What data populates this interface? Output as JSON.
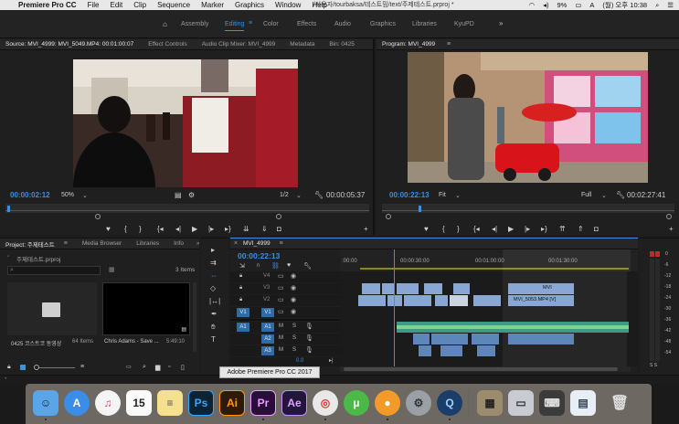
{
  "menubar": {
    "app_name": "Premiere Pro CC",
    "items": [
      "File",
      "Edit",
      "Clip",
      "Sequence",
      "Marker",
      "Graphics",
      "Window",
      "Help"
    ],
    "path_title": "/사용자/tourbaksa/테스트밈/text/주제테스트.prproj *",
    "battery": "9%",
    "clock": "(월) 오후 10:38"
  },
  "workspaces": [
    "Assembly",
    "Editing",
    "Color",
    "Effects",
    "Audio",
    "Graphics",
    "Libraries",
    "KyuPD"
  ],
  "active_workspace": "Editing",
  "source_panel": {
    "tabs": [
      "Source: MVI_4999: MVI_5049.MP4: 00:01:00:07",
      "Effect Controls",
      "Audio Clip Mixer: MVI_4999",
      "Metadata",
      "Bin: 0425"
    ],
    "timecode_in": "00:00:02:12",
    "zoom": "50%",
    "fraction": "1/2",
    "duration": "00:00:05:37"
  },
  "program_panel": {
    "tab": "Program: MVI_4999",
    "timecode": "00:00:22:13",
    "zoom": "Fit",
    "quality": "Full",
    "duration": "00:02:27:41"
  },
  "project_panel": {
    "tabs": [
      "Project: 주제테스트",
      "Media Browser",
      "Libraries",
      "Info"
    ],
    "file": "주제테스트.prproj",
    "item_count": "3 Items",
    "items": [
      {
        "name": "0425 코스트코 동영상",
        "meta": "64 Items"
      },
      {
        "name": "Chris Adams - Save ...",
        "meta": "5:49:10"
      }
    ]
  },
  "timeline": {
    "tab": "MVI_4999",
    "timecode": "00:00:22:13",
    "ruler": [
      ":00:00",
      "00:00:30:00",
      "00:01:00:00",
      "00:01:30:00"
    ],
    "video_tracks": [
      "V4",
      "V3",
      "V2",
      "V1"
    ],
    "audio_tracks": [
      "A1",
      "A2",
      "A3"
    ],
    "source_patch": [
      "V1",
      "A1"
    ],
    "clip_labels": [
      "MVI",
      "MVI_5053.MP4 [V]"
    ],
    "master_label": "0.0",
    "track_toggles": {
      "m": "M",
      "s": "S"
    }
  },
  "meter": {
    "scale": [
      "0",
      "-6",
      "-12",
      "-18",
      "-24",
      "-30",
      "-36",
      "-42",
      "-48",
      "-54"
    ],
    "channels": "S S"
  },
  "tooltip": "Adobe Premiere Pro CC 2017",
  "dock": {
    "apps": [
      "Finder",
      "App Store",
      "iTunes",
      "Calendar",
      "Notes",
      "Ps",
      "Ai",
      "Pr",
      "Ae",
      "Chrome",
      "uTorrent",
      "Ball",
      "System Preferences",
      "QuickTime",
      "Calculator",
      "Screenshot",
      "Keyboard",
      "Downloads",
      "Trash"
    ],
    "calendar_day": "15"
  }
}
